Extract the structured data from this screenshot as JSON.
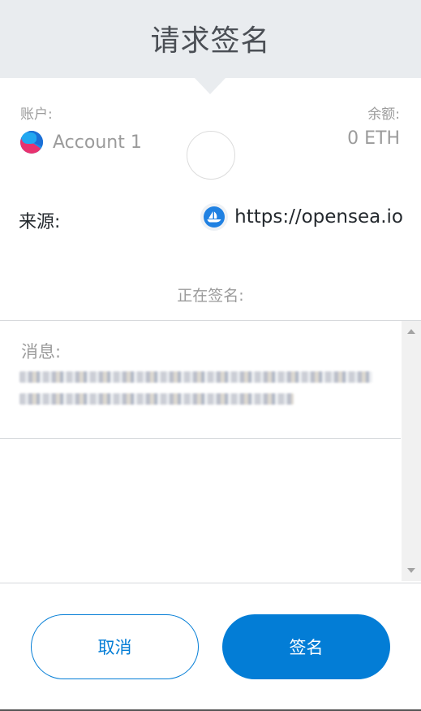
{
  "header": {
    "title": "请求签名"
  },
  "account": {
    "label": "账户:",
    "name": "Account 1",
    "balance_label": "余额:",
    "balance": "0 ETH"
  },
  "origin": {
    "label": "来源:",
    "icon": "opensea-icon",
    "url": "https://opensea.io"
  },
  "signing": {
    "label": "正在签名:"
  },
  "message": {
    "label": "消息:"
  },
  "buttons": {
    "cancel": "取消",
    "sign": "签名"
  },
  "colors": {
    "accent": "#037dd6",
    "header_bg": "#e9ecef",
    "muted": "#9b9b9b"
  }
}
